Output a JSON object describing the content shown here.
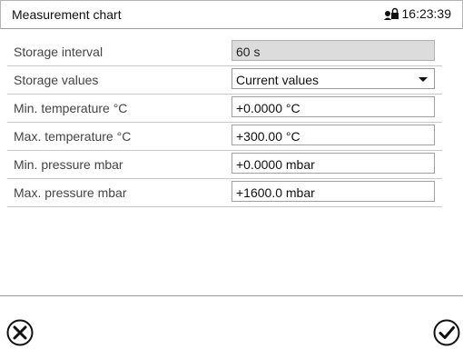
{
  "header": {
    "title": "Measurement chart",
    "time": "16:23:39",
    "lock_icon": "user-lock-icon"
  },
  "rows": [
    {
      "label": "Storage interval",
      "value": "60 s",
      "type": "readonly"
    },
    {
      "label": "Storage values",
      "value": "Current values",
      "type": "select"
    },
    {
      "label": "Min. temperature °C",
      "value": "+0.0000 °C",
      "type": "input"
    },
    {
      "label": "Max. temperature °C",
      "value": "+300.00 °C",
      "type": "input"
    },
    {
      "label": "Min. pressure mbar",
      "value": "+0.0000 mbar",
      "type": "input"
    },
    {
      "label": "Max. pressure mbar",
      "value": "+1600.0 mbar",
      "type": "input"
    }
  ],
  "footer": {
    "cancel_icon": "cancel-x-circle-icon",
    "confirm_icon": "confirm-check-circle-icon"
  },
  "colors": {
    "readonly_bg": "#dcdcdc",
    "border": "#a0a0a0",
    "divider": "#c8c8c8"
  }
}
